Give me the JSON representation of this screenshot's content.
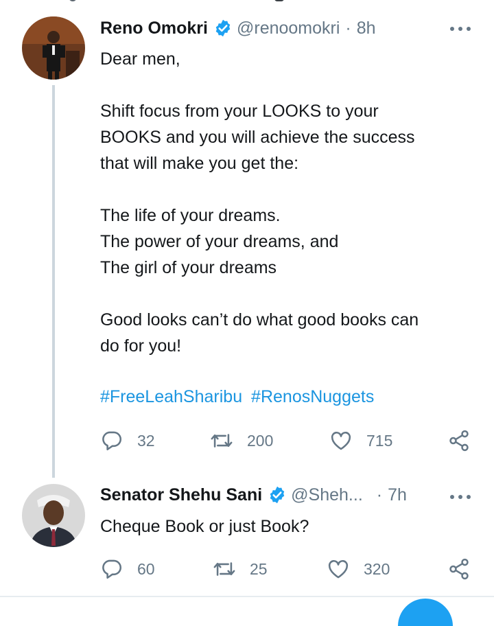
{
  "tweets": [
    {
      "author_name": "Reno Omokri",
      "handle": "@renoomokri",
      "separator": "·",
      "time": "8h",
      "body": "Dear men,\n\nShift focus from your LOOKS to your\nBOOKS and you will achieve the success\nthat will make you get the:\n\nThe life of your dreams.\nThe power of your dreams, and\nThe girl of your dreams\n\nGood looks can’t do what good books can\ndo for you!",
      "hashtags": [
        "#FreeLeahSharibu",
        "#RenosNuggets"
      ],
      "replies": "32",
      "retweets": "200",
      "likes": "715"
    },
    {
      "author_name": "Senator Shehu Sani",
      "handle": "@Sheh...",
      "separator": "·",
      "time": "7h",
      "body": "Cheque Book or just Book?",
      "replies": "60",
      "retweets": "25",
      "likes": "320"
    }
  ],
  "colors": {
    "accent": "#1b95e0",
    "verified": "#1da1f2",
    "secondary_text": "#657786",
    "thread_line": "#ccd6dd"
  },
  "icons": {
    "verified": "verified-badge-icon",
    "more": "more-options-icon",
    "reply": "reply-icon",
    "retweet": "retweet-icon",
    "like": "heart-icon",
    "share": "share-icon"
  }
}
